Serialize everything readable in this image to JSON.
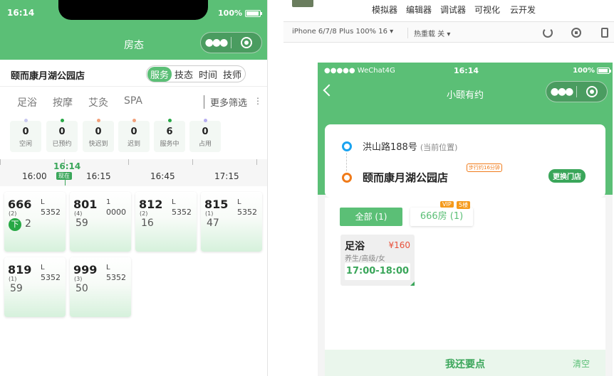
{
  "left_phone": {
    "status": {
      "time": "16:14",
      "battery": "100%"
    },
    "title": "房态",
    "store_name": "颐而康月湖公园店",
    "view_tabs": [
      {
        "label": "服务",
        "active": true
      },
      {
        "label": "技态",
        "active": false
      },
      {
        "label": "时间",
        "active": false
      },
      {
        "label": "技师",
        "active": false
      }
    ],
    "filters": [
      "足浴",
      "按摩",
      "艾灸",
      "SPA"
    ],
    "more_filters": "更多筛选",
    "stats": [
      {
        "count": "0",
        "label": "空闲",
        "color": "#c9c9ef"
      },
      {
        "count": "0",
        "label": "已预约",
        "color": "#27a845"
      },
      {
        "count": "0",
        "label": "快迟到",
        "color": "#f2a07a"
      },
      {
        "count": "0",
        "label": "迟到",
        "color": "#f2a07a"
      },
      {
        "count": "6",
        "label": "服务中",
        "color": "#27a845"
      },
      {
        "count": "0",
        "label": "占用",
        "color": "#b7aef0"
      }
    ],
    "timeline": {
      "times": [
        "16:00",
        "16:15",
        "16:45",
        "17:15"
      ],
      "now_time": "16:14",
      "now_label": "现在"
    },
    "rooms": [
      {
        "number": "666",
        "capacity": "(2)",
        "level": "L",
        "code": "5352",
        "bottom": "2",
        "down_badge": "下"
      },
      {
        "number": "801",
        "capacity": "(4)",
        "level": "1",
        "code": "0000",
        "bottom": "59",
        "down_badge": ""
      },
      {
        "number": "812",
        "capacity": "(2)",
        "level": "L",
        "code": "5352",
        "bottom": "16",
        "down_badge": ""
      },
      {
        "number": "815",
        "capacity": "(1)",
        "level": "L",
        "code": "5352",
        "bottom": "47",
        "down_badge": ""
      },
      {
        "number": "819",
        "capacity": "(1)",
        "level": "L",
        "code": "5352",
        "bottom": "59",
        "down_badge": ""
      },
      {
        "number": "999",
        "capacity": "(3)",
        "level": "L",
        "code": "5352",
        "bottom": "50",
        "down_badge": ""
      }
    ]
  },
  "ide": {
    "toolbar": [
      "模拟器",
      "编辑器",
      "调试器",
      "可视化",
      "云开发"
    ],
    "device": "iPhone 6/7/8 Plus 100% 16 ▾",
    "hot_reload": "热重载 关 ▾"
  },
  "sim": {
    "status": {
      "carrier": "●●●●● WeChat4G",
      "time": "16:14",
      "battery": "100%"
    },
    "title": "小颐有约",
    "address": "洪山路188号",
    "address_note": "(当前位置)",
    "store_name": "颐而康月湖公园店",
    "walk_tag": "步行约16分钟",
    "change_store": "更换门店",
    "all_button": "全部 (1)",
    "room_button": "666房 (1)",
    "tag_vip": "VIP",
    "tag_floor": "5楼",
    "service": {
      "name": "足浴",
      "price": "¥160",
      "desc": "养生/高级/女",
      "time": "17:00-18:00"
    },
    "footer_more": "我还要点",
    "footer_clear": "清空"
  }
}
